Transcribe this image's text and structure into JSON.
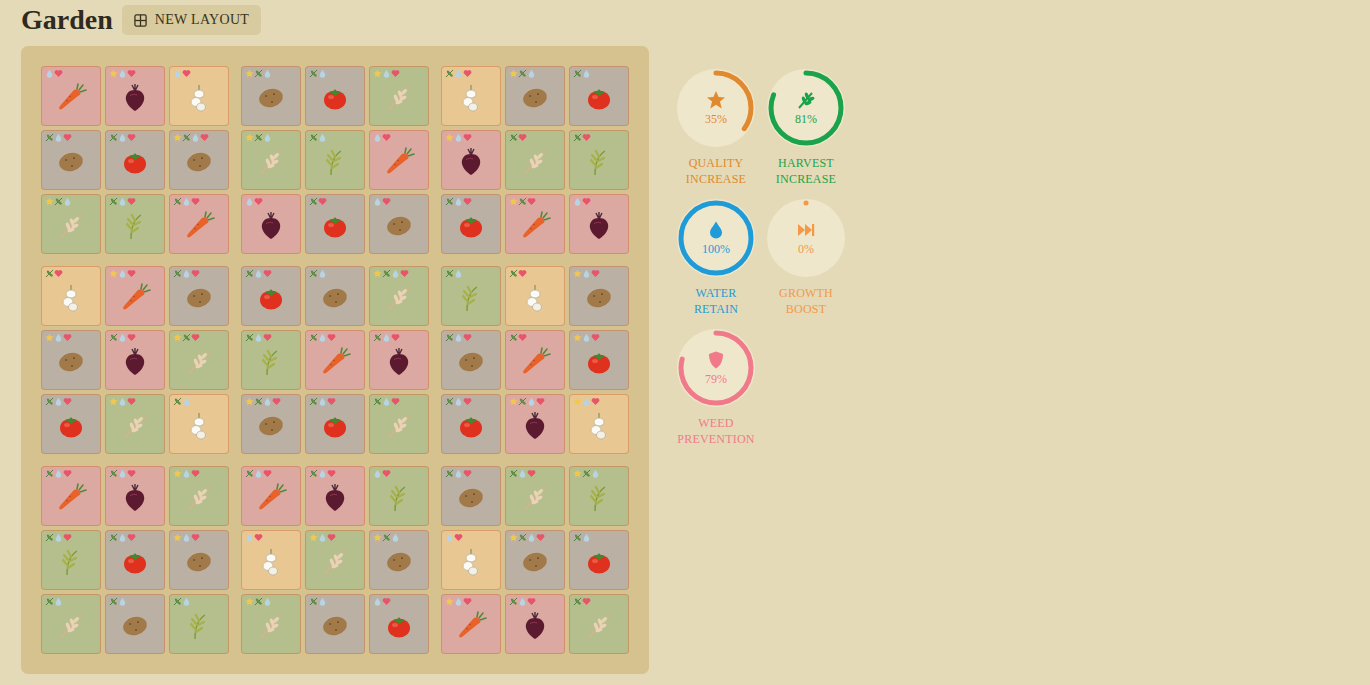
{
  "header": {
    "title": "Garden",
    "button": "NEW LAYOUT"
  },
  "garden": {
    "rows": [
      [
        {
          "kind": "carrot",
          "effects": [
            "drop",
            "heart"
          ]
        },
        {
          "kind": "beet",
          "effects": [
            "star",
            "drop",
            "heart"
          ]
        },
        {
          "kind": "garlic",
          "effects": [
            "drop",
            "heart"
          ]
        },
        {
          "kind": "potato",
          "effects": [
            "star",
            "leaf",
            "drop"
          ]
        },
        {
          "kind": "tomato",
          "effects": [
            "leaf",
            "drop"
          ]
        },
        {
          "kind": "wheat",
          "effects": [
            "star",
            "drop",
            "heart"
          ]
        },
        {
          "kind": "garlic",
          "effects": [
            "leaf",
            "drop",
            "heart"
          ]
        },
        {
          "kind": "potato",
          "effects": [
            "star",
            "leaf",
            "drop"
          ]
        },
        {
          "kind": "tomato",
          "effects": [
            "leaf",
            "drop"
          ]
        }
      ],
      [
        {
          "kind": "potato",
          "effects": [
            "leaf",
            "drop",
            "heart"
          ]
        },
        {
          "kind": "tomato",
          "effects": [
            "leaf",
            "drop",
            "heart"
          ]
        },
        {
          "kind": "potato",
          "effects": [
            "star",
            "leaf",
            "drop",
            "heart"
          ]
        },
        {
          "kind": "wheat",
          "effects": [
            "star",
            "leaf",
            "drop"
          ]
        },
        {
          "kind": "rice",
          "effects": [
            "leaf",
            "drop"
          ]
        },
        {
          "kind": "carrot",
          "effects": [
            "drop",
            "heart"
          ]
        },
        {
          "kind": "beet",
          "effects": [
            "star",
            "drop",
            "heart"
          ]
        },
        {
          "kind": "wheat",
          "effects": [
            "leaf",
            "heart"
          ]
        },
        {
          "kind": "rice",
          "effects": [
            "leaf",
            "heart"
          ]
        }
      ],
      [
        {
          "kind": "wheat",
          "effects": [
            "star",
            "leaf",
            "drop"
          ]
        },
        {
          "kind": "rice",
          "effects": [
            "leaf",
            "drop",
            "heart"
          ]
        },
        {
          "kind": "carrot",
          "effects": [
            "leaf",
            "drop",
            "heart"
          ]
        },
        {
          "kind": "beet",
          "effects": [
            "drop",
            "heart"
          ]
        },
        {
          "kind": "tomato",
          "effects": [
            "leaf",
            "heart"
          ]
        },
        {
          "kind": "potato",
          "effects": [
            "drop",
            "heart"
          ]
        },
        {
          "kind": "tomato",
          "effects": [
            "leaf",
            "drop",
            "heart"
          ]
        },
        {
          "kind": "carrot",
          "effects": [
            "star",
            "leaf",
            "heart"
          ]
        },
        {
          "kind": "beet",
          "effects": [
            "drop",
            "heart"
          ]
        }
      ],
      [
        {
          "kind": "garlic",
          "effects": [
            "leaf",
            "heart"
          ]
        },
        {
          "kind": "carrot",
          "effects": [
            "star",
            "drop",
            "heart"
          ]
        },
        {
          "kind": "potato",
          "effects": [
            "leaf",
            "drop",
            "heart"
          ]
        },
        {
          "kind": "tomato",
          "effects": [
            "leaf",
            "drop",
            "heart"
          ]
        },
        {
          "kind": "potato",
          "effects": [
            "leaf",
            "drop"
          ]
        },
        {
          "kind": "wheat",
          "effects": [
            "star",
            "leaf",
            "drop",
            "heart"
          ]
        },
        {
          "kind": "rice",
          "effects": [
            "leaf",
            "drop"
          ]
        },
        {
          "kind": "garlic",
          "effects": [
            "leaf",
            "heart"
          ]
        },
        {
          "kind": "potato",
          "effects": [
            "star",
            "drop",
            "heart"
          ]
        }
      ],
      [
        {
          "kind": "potato",
          "effects": [
            "star",
            "drop",
            "heart"
          ]
        },
        {
          "kind": "beet",
          "effects": [
            "leaf",
            "drop",
            "heart"
          ]
        },
        {
          "kind": "wheat",
          "effects": [
            "star",
            "leaf",
            "heart"
          ]
        },
        {
          "kind": "rice",
          "effects": [
            "leaf",
            "drop",
            "heart"
          ]
        },
        {
          "kind": "carrot",
          "effects": [
            "leaf",
            "drop",
            "heart"
          ]
        },
        {
          "kind": "beet",
          "effects": [
            "leaf",
            "drop",
            "heart"
          ]
        },
        {
          "kind": "potato",
          "effects": [
            "leaf",
            "drop",
            "heart"
          ]
        },
        {
          "kind": "carrot",
          "effects": [
            "leaf",
            "heart"
          ]
        },
        {
          "kind": "tomato",
          "effects": [
            "star",
            "drop",
            "heart"
          ]
        }
      ],
      [
        {
          "kind": "tomato",
          "effects": [
            "leaf",
            "drop",
            "heart"
          ]
        },
        {
          "kind": "wheat",
          "effects": [
            "star",
            "drop",
            "heart"
          ]
        },
        {
          "kind": "garlic",
          "effects": [
            "leaf",
            "drop"
          ]
        },
        {
          "kind": "potato",
          "effects": [
            "star",
            "leaf",
            "drop",
            "heart"
          ]
        },
        {
          "kind": "tomato",
          "effects": [
            "leaf",
            "drop",
            "heart"
          ]
        },
        {
          "kind": "wheat",
          "effects": [
            "leaf",
            "drop",
            "heart"
          ]
        },
        {
          "kind": "tomato",
          "effects": [
            "leaf",
            "drop",
            "heart"
          ]
        },
        {
          "kind": "beet",
          "effects": [
            "star",
            "leaf",
            "drop",
            "heart"
          ]
        },
        {
          "kind": "garlic",
          "effects": [
            "star",
            "drop",
            "heart"
          ]
        }
      ],
      [
        {
          "kind": "carrot",
          "effects": [
            "leaf",
            "drop",
            "heart"
          ]
        },
        {
          "kind": "beet",
          "effects": [
            "leaf",
            "drop",
            "heart"
          ]
        },
        {
          "kind": "wheat",
          "effects": [
            "star",
            "drop",
            "heart"
          ]
        },
        {
          "kind": "carrot",
          "effects": [
            "leaf",
            "drop",
            "heart"
          ]
        },
        {
          "kind": "beet",
          "effects": [
            "leaf",
            "drop",
            "heart"
          ]
        },
        {
          "kind": "rice",
          "effects": [
            "drop",
            "heart"
          ]
        },
        {
          "kind": "potato",
          "effects": [
            "leaf",
            "drop",
            "heart"
          ]
        },
        {
          "kind": "wheat",
          "effects": [
            "leaf",
            "drop",
            "heart"
          ]
        },
        {
          "kind": "rice",
          "effects": [
            "star",
            "leaf",
            "drop"
          ]
        }
      ],
      [
        {
          "kind": "rice",
          "effects": [
            "leaf",
            "drop",
            "heart"
          ]
        },
        {
          "kind": "tomato",
          "effects": [
            "leaf",
            "drop",
            "heart"
          ]
        },
        {
          "kind": "potato",
          "effects": [
            "star",
            "drop",
            "heart"
          ]
        },
        {
          "kind": "garlic",
          "effects": [
            "drop",
            "heart"
          ]
        },
        {
          "kind": "wheat",
          "effects": [
            "star",
            "drop",
            "heart"
          ]
        },
        {
          "kind": "potato",
          "effects": [
            "star",
            "leaf",
            "drop"
          ]
        },
        {
          "kind": "garlic",
          "effects": [
            "drop",
            "heart"
          ]
        },
        {
          "kind": "potato",
          "effects": [
            "star",
            "leaf",
            "drop",
            "heart"
          ]
        },
        {
          "kind": "tomato",
          "effects": [
            "leaf",
            "drop"
          ]
        }
      ],
      [
        {
          "kind": "wheat",
          "effects": [
            "leaf",
            "drop"
          ]
        },
        {
          "kind": "potato",
          "effects": [
            "leaf",
            "drop"
          ]
        },
        {
          "kind": "rice",
          "effects": [
            "leaf",
            "drop"
          ]
        },
        {
          "kind": "wheat",
          "effects": [
            "star",
            "leaf",
            "drop"
          ]
        },
        {
          "kind": "potato",
          "effects": [
            "leaf",
            "drop"
          ]
        },
        {
          "kind": "tomato",
          "effects": [
            "drop",
            "heart"
          ]
        },
        {
          "kind": "carrot",
          "effects": [
            "star",
            "drop",
            "heart"
          ]
        },
        {
          "kind": "beet",
          "effects": [
            "leaf",
            "drop",
            "heart"
          ]
        },
        {
          "kind": "wheat",
          "effects": [
            "leaf",
            "heart"
          ]
        }
      ]
    ]
  },
  "stats": [
    {
      "kind": "quality",
      "label": "QUALITY INCREASE",
      "value": "35%",
      "level": 0.35,
      "color": "#e0892e"
    },
    {
      "kind": "harvest",
      "label": "HARVEST INCREASE",
      "value": "81%",
      "level": 0.81,
      "color": "#1aa34a"
    },
    {
      "kind": "water",
      "label": "WATER RETAIN",
      "value": "100%",
      "level": 1.0,
      "color": "#1f9bd8"
    },
    {
      "kind": "growth",
      "label": "GROWTH BOOST",
      "value": "0%",
      "level": 0.0,
      "color": "#f2994a"
    },
    {
      "kind": "weed",
      "label": "WEED PREVENTION",
      "value": "79%",
      "level": 0.79,
      "color": "#f07a8a"
    }
  ]
}
